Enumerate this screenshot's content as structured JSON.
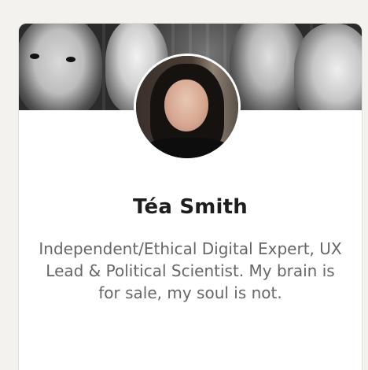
{
  "profile": {
    "name": "Téa Smith",
    "bio": "Independent/Ethical Digital Expert, UX Lead & Political Scientist. My brain is for sale, my soul is not."
  }
}
